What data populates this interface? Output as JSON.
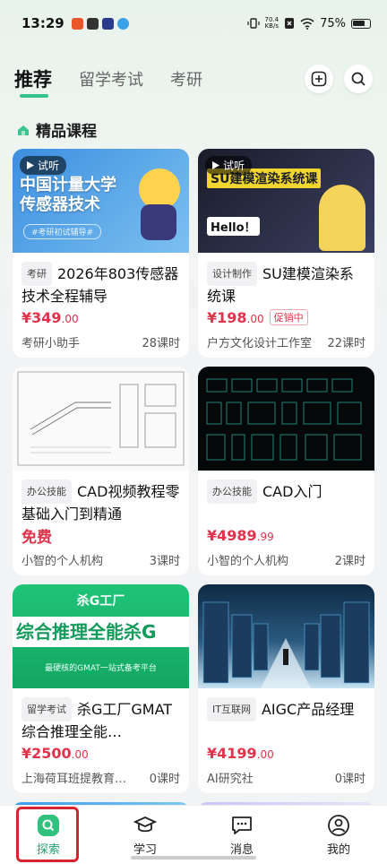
{
  "status": {
    "time": "13:29",
    "speed_top": "70.4",
    "speed_bottom": "KB/s",
    "battery": "75%"
  },
  "topnav": {
    "tabs": [
      {
        "label": "推荐"
      },
      {
        "label": "留学考试"
      },
      {
        "label": "考研"
      }
    ]
  },
  "section": {
    "title": "精品课程"
  },
  "cards": [
    {
      "trial": "试听",
      "category": "考研",
      "title": "2026年803传感器技术全程辅导",
      "price_main": "¥349",
      "price_decimal": ".00",
      "seller": "考研小助手",
      "lessons": "28课时",
      "thumb_text": [
        "中国计量大学",
        "传感器技术",
        "#考研初试辅导#"
      ]
    },
    {
      "trial": "试听",
      "category": "设计制作",
      "title": "SU建模渲染系统课",
      "price_main": "¥198",
      "price_decimal": ".00",
      "promo": "促销中",
      "seller": "户方文化设计工作室",
      "lessons": "22课时",
      "thumb_text": [
        "SU建模渲染系统课",
        "Hello！"
      ]
    },
    {
      "category": "办公技能",
      "title": "CAD视频教程零基础入门到精通",
      "price_free": "免费",
      "seller": "小智的个人机构",
      "lessons": "3课时"
    },
    {
      "category": "办公技能",
      "title": "CAD入门",
      "price_main": "¥4989",
      "price_decimal": ".99",
      "seller": "小智的个人机构",
      "lessons": "2课时"
    },
    {
      "category": "留学考试",
      "title": "杀G工厂GMAT综合推理全能…",
      "price_main": "¥2500",
      "price_decimal": ".00",
      "seller": "上海荷耳班提教育…",
      "lessons": "0课时",
      "thumb_text": [
        "杀G工厂",
        "综合推理全能杀G",
        "最硬核的GMAT一站式备考平台"
      ]
    },
    {
      "category": "IT互联网",
      "title": "AIGC产品经理",
      "price_main": "¥4199",
      "price_decimal": ".00",
      "seller": "AI研究社",
      "lessons": "0课时"
    }
  ],
  "bottom_nav": [
    {
      "label": "探索"
    },
    {
      "label": "学习"
    },
    {
      "label": "消息"
    },
    {
      "label": "我的"
    }
  ],
  "colors": {
    "accent": "#22a06b",
    "price": "#e0334b",
    "highlight": "#d9232f"
  }
}
